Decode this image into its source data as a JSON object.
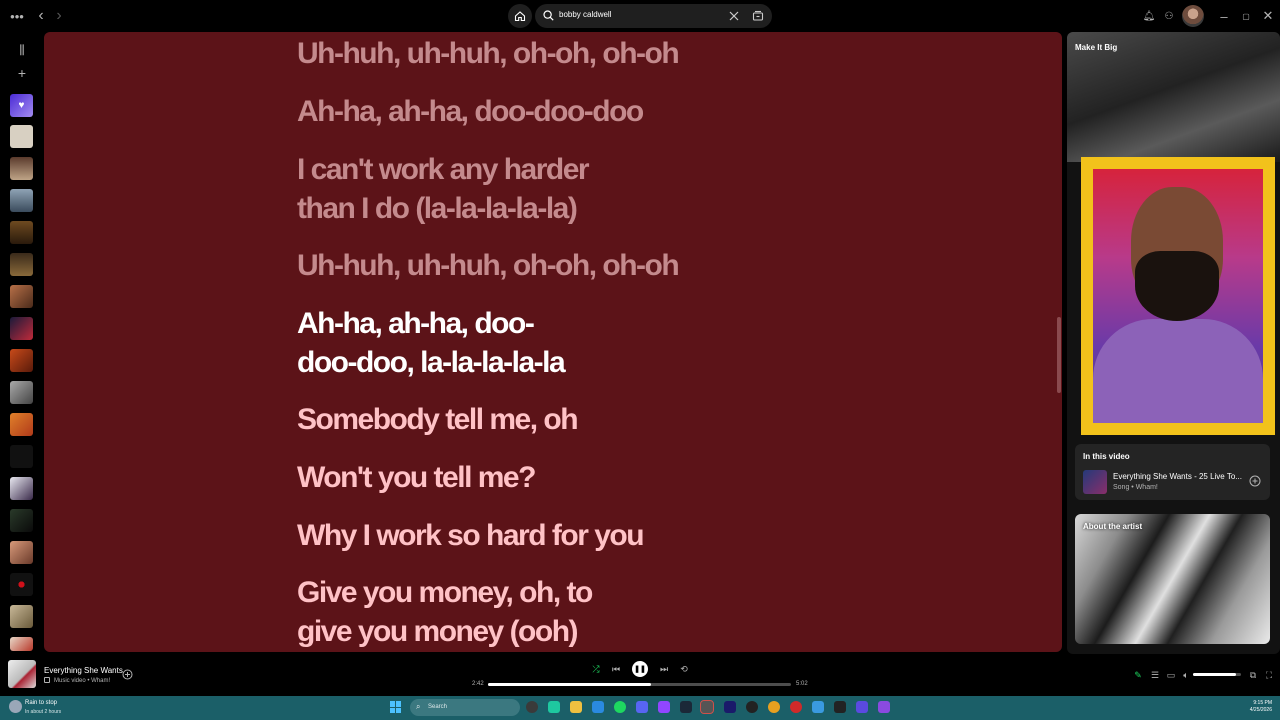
{
  "topbar": {
    "search_value": "bobby caldwell",
    "icons": [
      "more-icon",
      "back-icon",
      "forward-icon",
      "home-icon",
      "search-icon",
      "clear-icon",
      "browse-icon",
      "bell-icon",
      "friends-icon",
      "minimize-icon",
      "maximize-icon",
      "close-icon"
    ]
  },
  "lyrics": {
    "background": "#5c1318",
    "lines": [
      {
        "text": "Uh-huh, uh-huh, oh-oh, oh-oh",
        "state": "past"
      },
      {
        "text": "Ah-ha, ah-ha, doo-doo-doo",
        "state": "past"
      },
      {
        "text": "I can't work any harder",
        "state": "past"
      },
      {
        "text": "than I do (la-la-la-la-la)",
        "state": "past"
      },
      {
        "text": "Uh-huh, uh-huh, oh-oh, oh-oh",
        "state": "past"
      },
      {
        "text": "Ah-ha, ah-ha, doo-",
        "state": "current"
      },
      {
        "text": "doo-doo, la-la-la-la-la",
        "state": "current"
      },
      {
        "text": "Somebody tell me, oh",
        "state": "future"
      },
      {
        "text": "Won't you tell me?",
        "state": "future"
      },
      {
        "text": "Why I work so hard for you",
        "state": "future"
      },
      {
        "text": "Give you money, oh, to",
        "state": "future"
      },
      {
        "text": "give you money (ooh)",
        "state": "future"
      }
    ]
  },
  "right_panel": {
    "title": "Make It Big",
    "in_this_video": {
      "heading": "In this video",
      "track_title": "Everything She Wants - 25 Live To...",
      "track_sub": "Song • Wham!"
    },
    "about_artist": {
      "heading": "About the artist"
    }
  },
  "player": {
    "track_title": "Everything She Wants",
    "track_sub": "Music video • Wham!",
    "elapsed": "2:42",
    "duration": "5:02",
    "progress": 0.537,
    "volume": 0.9
  },
  "taskbar": {
    "weather_title": "Rain to stop",
    "weather_sub": "In about 2 hours",
    "search_placeholder": "Search",
    "time": "9:15 PM",
    "date": "4/25/2026"
  }
}
